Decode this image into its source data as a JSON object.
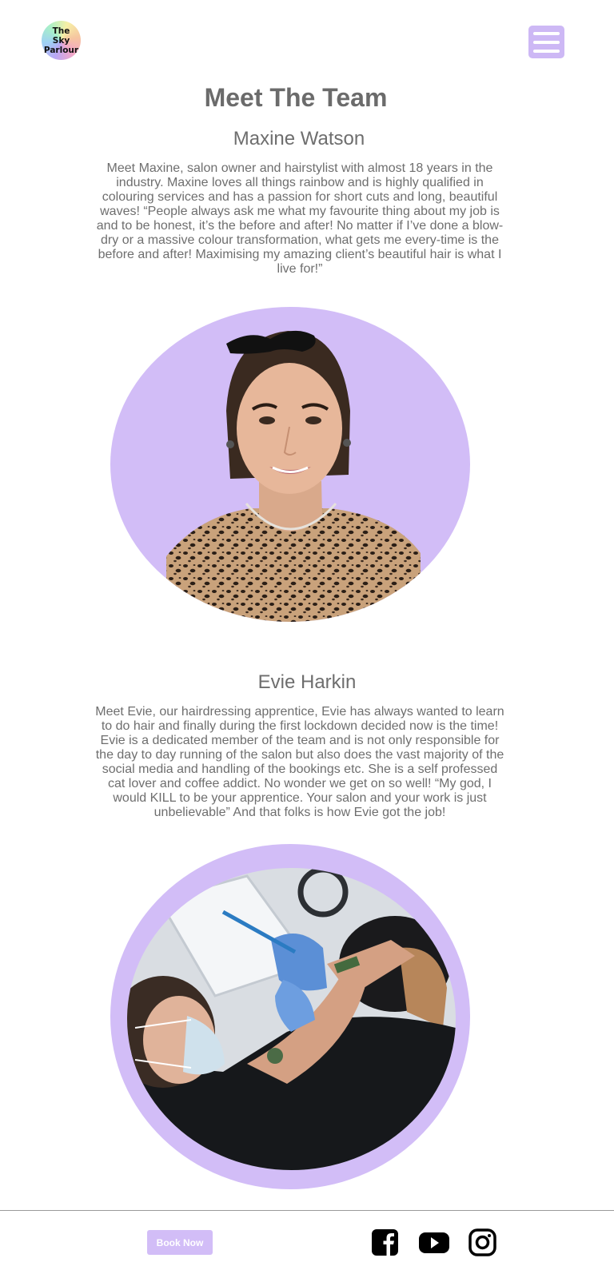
{
  "header": {
    "logo_line1": "The Sky",
    "logo_line2": "Parlour",
    "menu_icon": "hamburger-menu-icon"
  },
  "page": {
    "title": "Meet The Team"
  },
  "team": [
    {
      "name": "Maxine Watson",
      "bio": "Meet Maxine, salon owner and hairstylist with almost 18 years in the industry. Maxine loves all things rainbow and is highly qualified in colouring services and has a passion for short cuts and long, beautiful waves! “People always ask me what my favourite thing about my job is and to be honest, it’s the before and after! No matter if I’ve done a blow-dry or a massive colour transformation, what gets me every-time is the before and after! Maximising my amazing client’s beautiful hair is what I live for!”"
    },
    {
      "name": "Evie Harkin",
      "bio": "Meet Evie, our hairdressing apprentice, Evie has always wanted to learn to do hair and finally during the first lockdown decided now is the time! Evie is a dedicated member of the team and is not only responsible for the day to day running of the salon but also does the vast majority of the social media and handling of the bookings etc. She is a self professed cat lover and coffee addict. No wonder we get on so well! “My god, I would KILL to be your apprentice. Your salon and your work is just unbelievable” And that folks is how Evie got the job!"
    }
  ],
  "footer": {
    "book_label": "Book Now",
    "social_icons": [
      "facebook-icon",
      "youtube-icon",
      "instagram-icon"
    ]
  },
  "colors": {
    "accent": "#d2bdf7",
    "menu": "#cdb8f5",
    "text": "#6e6e6e"
  }
}
